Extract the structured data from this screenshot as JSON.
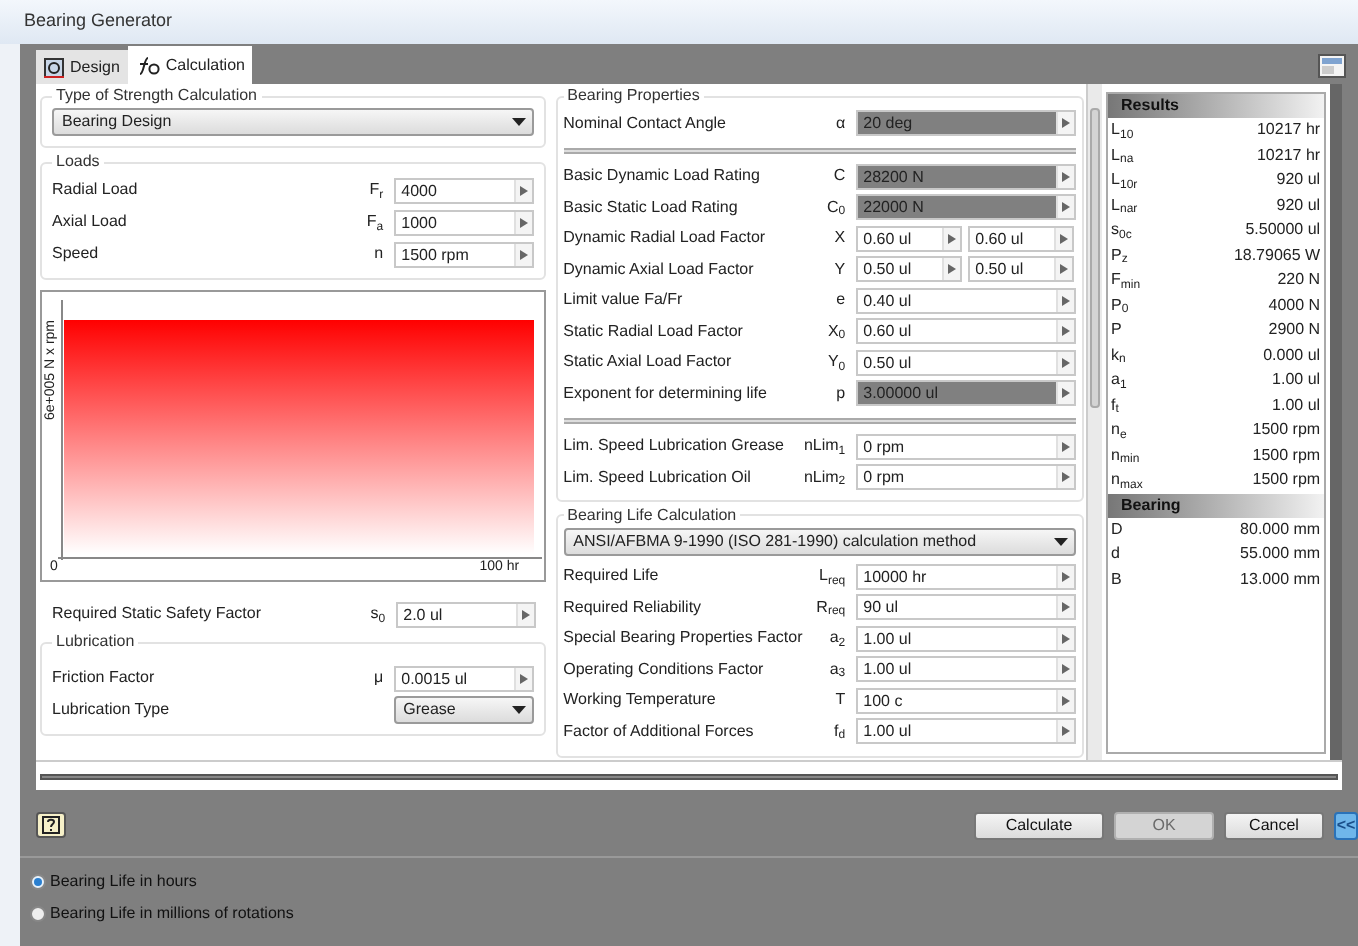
{
  "window": {
    "title": "Bearing Generator"
  },
  "tabs": [
    {
      "label": "Design",
      "selected": false
    },
    {
      "label": "Calculation",
      "selected": true
    }
  ],
  "strength": {
    "title": "Type of Strength Calculation",
    "value": "Bearing Design"
  },
  "loads": {
    "title": "Loads",
    "rows": [
      {
        "label": "Radial Load",
        "symbol": "F$_{r}$",
        "value": "4000"
      },
      {
        "label": "Axial Load",
        "symbol": "F$_{a}$",
        "value": "1000"
      },
      {
        "label": "Speed",
        "symbol": "n",
        "value": "1500 rpm"
      }
    ]
  },
  "chart": {
    "y_label": "6e+005 N x rpm",
    "x_start": "0",
    "x_end": "100 hr"
  },
  "safety": {
    "label": "Required Static Safety Factor",
    "symbol": "s$_{0}$",
    "value": "2.0 ul"
  },
  "lubrication": {
    "title": "Lubrication",
    "rows": [
      {
        "kind": "field",
        "label": "Friction Factor",
        "symbol": "μ",
        "value": "0.0015 ul"
      },
      {
        "kind": "dropdown",
        "label": "Lubrication Type",
        "value": "Grease"
      }
    ]
  },
  "bearing_properties": {
    "title": "Bearing Properties",
    "groups": [
      {
        "rows": [
          {
            "label": "Nominal Contact Angle",
            "symbol": "α",
            "values": [
              "20 deg"
            ],
            "disabled": true
          }
        ]
      },
      {
        "rows": [
          {
            "label": "Basic Dynamic Load Rating",
            "symbol": "C",
            "values": [
              "28200 N"
            ],
            "disabled": true
          },
          {
            "label": "Basic Static Load Rating",
            "symbol": "C$_{0}$",
            "values": [
              "22000 N"
            ],
            "disabled": true
          },
          {
            "label": "Dynamic Radial Load Factor",
            "symbol": "X",
            "values": [
              "0.60 ul",
              "0.60 ul"
            ],
            "disabled": false
          },
          {
            "label": "Dynamic Axial Load Factor",
            "symbol": "Y",
            "values": [
              "0.50 ul",
              "0.50 ul"
            ],
            "disabled": false
          },
          {
            "label": "Limit value Fa/Fr",
            "symbol": "e",
            "values": [
              "0.40 ul"
            ],
            "disabled": false
          },
          {
            "label": "Static Radial Load Factor",
            "symbol": "X$_{0}$",
            "values": [
              "0.60 ul"
            ],
            "disabled": false
          },
          {
            "label": "Static Axial Load Factor",
            "symbol": "Y$_{0}$",
            "values": [
              "0.50 ul"
            ],
            "disabled": false
          },
          {
            "label": "Exponent for determining life",
            "symbol": "p",
            "values": [
              "3.00000 ul"
            ],
            "disabled": true
          }
        ]
      },
      {
        "rows": [
          {
            "label": "Lim. Speed Lubrication Grease",
            "symbol": "nLim$_{1}$",
            "values": [
              "0 rpm"
            ],
            "disabled": false
          },
          {
            "label": "Lim. Speed Lubrication Oil",
            "symbol": "nLim$_{2}$",
            "values": [
              "0 rpm"
            ],
            "disabled": false
          }
        ]
      }
    ]
  },
  "life": {
    "title": "Bearing Life Calculation",
    "method": "ANSI/AFBMA 9-1990 (ISO 281-1990) calculation method",
    "rows": [
      {
        "label": "Required Life",
        "symbol": "L$_{req}$",
        "values": [
          "10000 hr"
        ],
        "disabled": false
      },
      {
        "label": "Required Reliability",
        "symbol": "R$_{req}$",
        "values": [
          "90 ul"
        ],
        "disabled": false
      },
      {
        "label": "Special Bearing Properties Factor",
        "symbol": "a$_{2}$",
        "values": [
          "1.00 ul"
        ],
        "disabled": false
      },
      {
        "label": "Operating Conditions Factor",
        "symbol": "a$_{3}$",
        "values": [
          "1.00 ul"
        ],
        "disabled": false
      },
      {
        "label": "Working Temperature",
        "symbol": "T",
        "values": [
          "100 c"
        ],
        "disabled": false
      },
      {
        "label": "Factor of Additional Forces",
        "symbol": "f$_{d}$",
        "values": [
          "1.00 ul"
        ],
        "disabled": false
      }
    ]
  },
  "results": {
    "title": "Results",
    "rows": [
      {
        "symbol": "L$_{10}$",
        "value": "10217 hr"
      },
      {
        "symbol": "L$_{na}$",
        "value": "10217 hr"
      },
      {
        "symbol": "L$_{10r}$",
        "value": "920 ul"
      },
      {
        "symbol": "L$_{nar}$",
        "value": "920 ul"
      },
      {
        "symbol": "s$_{0c}$",
        "value": "5.50000 ul"
      },
      {
        "symbol": "P$_{z}$",
        "value": "18.79065 W"
      },
      {
        "symbol": "F$_{min}$",
        "value": "220 N"
      },
      {
        "symbol": "P$_{0}$",
        "value": "4000 N"
      },
      {
        "symbol": "P",
        "value": "2900 N"
      },
      {
        "symbol": "k$_{n}$",
        "value": "0.000 ul"
      },
      {
        "symbol": "a$_{1}$",
        "value": "1.00 ul"
      },
      {
        "symbol": "f$_{t}$",
        "value": "1.00 ul"
      },
      {
        "symbol": "n$_{e}$",
        "value": "1500 rpm"
      },
      {
        "symbol": "n$_{min}$",
        "value": "1500 rpm"
      },
      {
        "symbol": "n$_{max}$",
        "value": "1500 rpm"
      }
    ]
  },
  "bearing": {
    "title": "Bearing",
    "rows": [
      {
        "symbol": "D",
        "value": "80.000 mm"
      },
      {
        "symbol": "d",
        "value": "55.000 mm"
      },
      {
        "symbol": "B",
        "value": "13.000 mm"
      }
    ]
  },
  "buttons": [
    {
      "label": "Calculate",
      "disabled": false
    },
    {
      "label": "OK",
      "disabled": true
    },
    {
      "label": "Cancel",
      "disabled": false
    },
    {
      "label": "<<",
      "disabled": false
    }
  ],
  "radios": [
    {
      "label": "Bearing Life in hours",
      "selected": true
    },
    {
      "label": "Bearing Life in millions of rotations",
      "selected": false
    }
  ]
}
